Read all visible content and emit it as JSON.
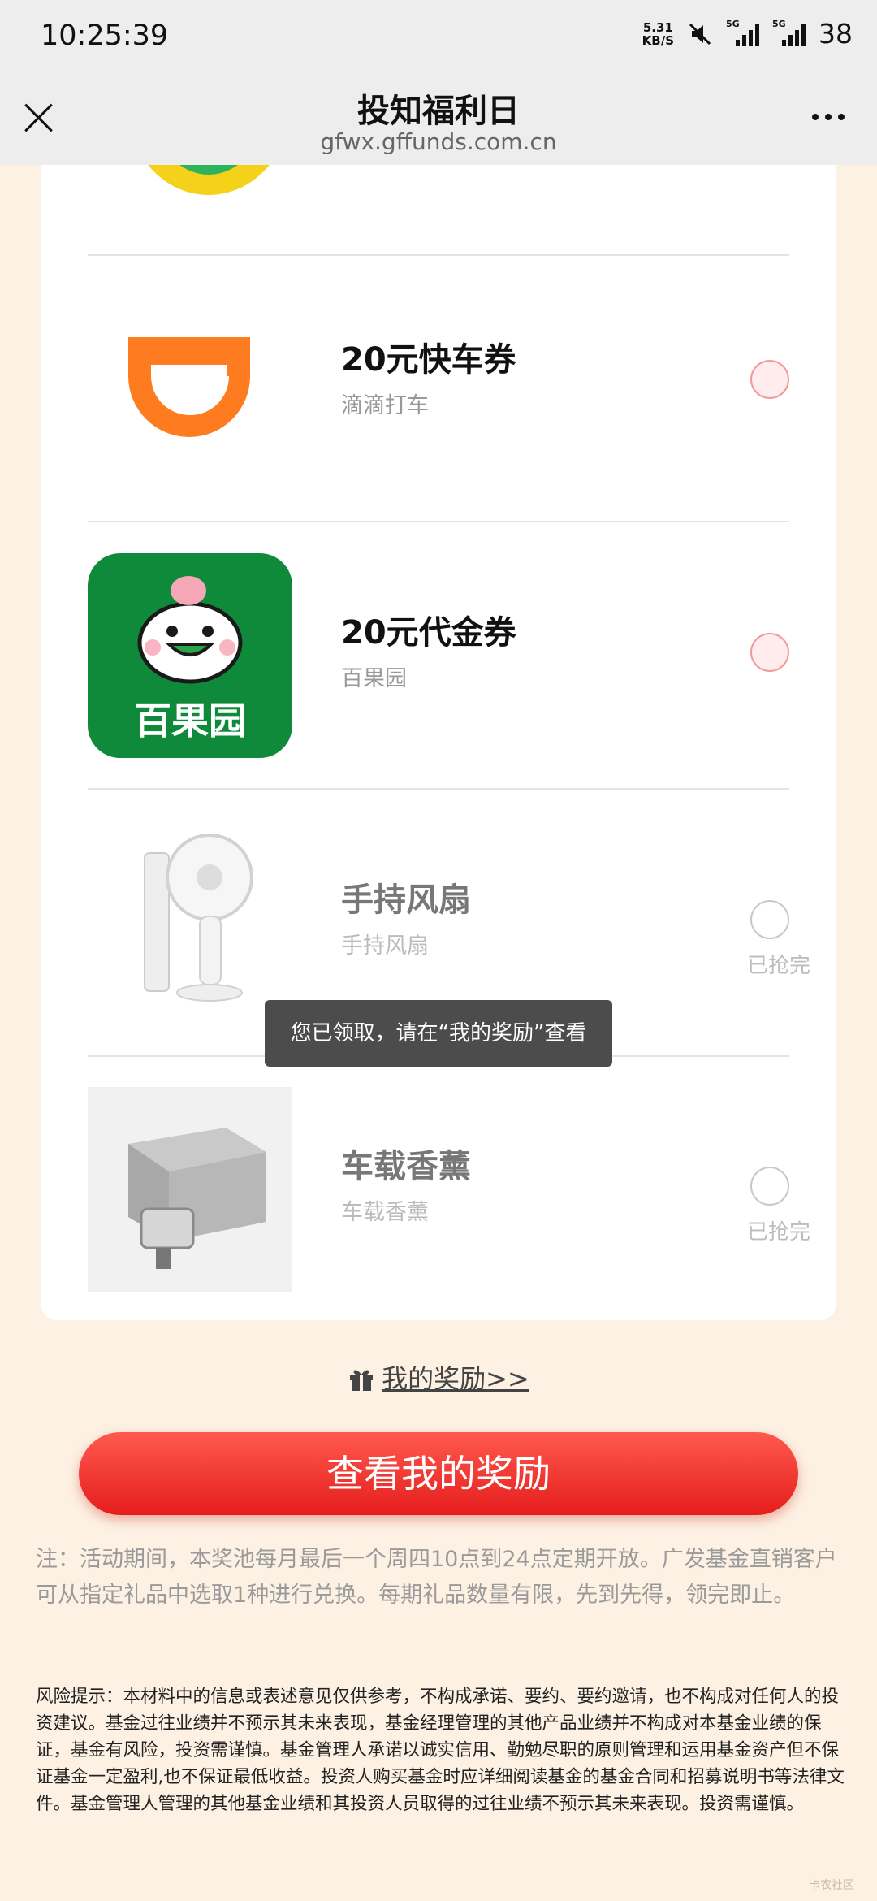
{
  "status_bar": {
    "time": "10:25:39",
    "net_speed_value": "5.31",
    "net_speed_unit": "KB/S",
    "sig1_label": "5G",
    "sig2_label": "5G",
    "battery": "38"
  },
  "nav": {
    "title": "投知福利日",
    "url": "gfwx.gffunds.com.cn"
  },
  "gifts": [
    {
      "name": "20元快车券",
      "brand": "滴滴打车",
      "status": ""
    },
    {
      "name": "20元代金券",
      "brand": "百果园",
      "status": "",
      "logo_text": "百果园"
    },
    {
      "name": "手持风扇",
      "brand": "手持风扇",
      "status": "已抢完"
    },
    {
      "name": "车载香薰",
      "brand": "车载香薰",
      "status": "已抢完"
    }
  ],
  "toast": "您已领取，请在“我的奖励”查看",
  "my_rewards_link": "我的奖励>>",
  "main_button": "查看我的奖励",
  "note": "注：活动期间，本奖池每月最后一个周四10点到24点定期开放。广发基金直销客户可从指定礼品中选取1种进行兑换。每期礼品数量有限，先到先得，领完即止。",
  "risk": "风险提示：本材料中的信息或表述意见仅供参考，不构成承诺、要约、要约邀请，也不构成对任何人的投资建议。基金过往业绩并不预示其未来表现，基金经理管理的其他产品业绩并不构成对本基金业绩的保证，基金有风险，投资需谨慎。基金管理人承诺以诚实信用、勤勉尽职的原则管理和运用基金资产但不保证基金一定盈利,也不保证最低收益。投资人购买基金时应详细阅读基金的基金合同和招募说明书等法律文件。基金管理人管理的其他基金业绩和其投资人员取得的过往业绩不预示其未来表现。投资需谨慎。",
  "watermark": "卡农社区",
  "colors": {
    "accent_red": "#e51d1d",
    "page_bg": "#fdf1e3",
    "didi_orange": "#ff7b1f",
    "baiguoyuan_green": "#0f8a3a"
  }
}
